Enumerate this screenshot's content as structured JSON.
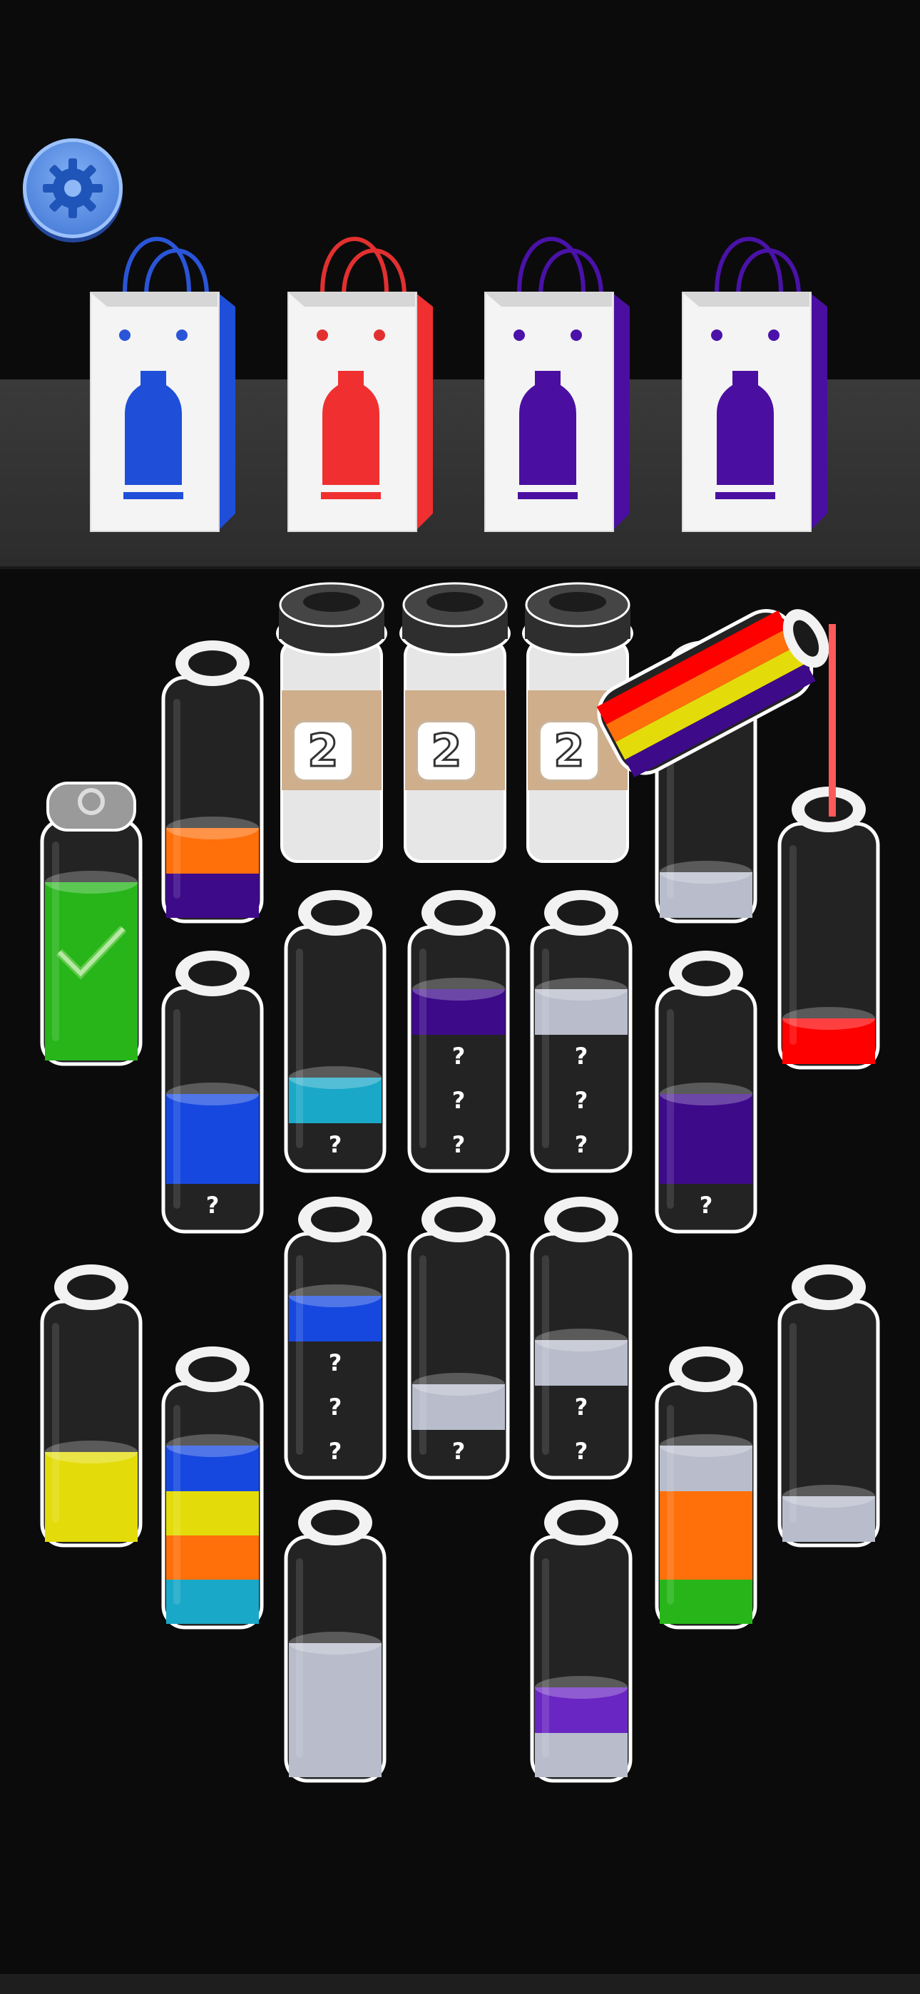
{
  "game": {
    "settings": {
      "icon": "gear-icon",
      "color": "#4a80e0"
    },
    "bags": [
      {
        "color": "#1f4fd8",
        "handle": "#2a55d8"
      },
      {
        "color": "#f03030",
        "handle": "#e23030"
      },
      {
        "color": "#4a0fa0",
        "handle": "#4a12a8"
      },
      {
        "color": "#4a0fa0",
        "handle": "#4a12a8"
      }
    ],
    "cups": [
      {
        "label": "2"
      },
      {
        "label": "2"
      },
      {
        "label": "2"
      }
    ],
    "colors": {
      "orange": "#ff6f0a",
      "purple": "#3d0a8a",
      "violet": "#6a26c2",
      "blue": "#1648e0",
      "cyan": "#1aa8c8",
      "gray": "#b8bccb",
      "red": "#ff0000",
      "yellow": "#e3dc0a",
      "green": "#27b51a",
      "dark": "#222222"
    },
    "bottles": [
      {
        "id": "b1",
        "layers": [
          "purple",
          "orange"
        ],
        "unknown": 0,
        "lid": false
      },
      {
        "id": "b2",
        "layers": [
          "gray"
        ],
        "unknown": 0,
        "lid": false
      },
      {
        "id": "b3",
        "layers": [
          "red"
        ],
        "unknown": 0,
        "lid": false
      },
      {
        "id": "b4",
        "layers": [
          "green",
          "green",
          "green",
          "green"
        ],
        "unknown": 0,
        "lid": true,
        "complete": true
      },
      {
        "id": "b5",
        "layers": [
          "blue",
          "blue"
        ],
        "unknown": 1,
        "lid": false
      },
      {
        "id": "b6",
        "layers": [
          "cyan"
        ],
        "unknown": 1,
        "lid": false
      },
      {
        "id": "b7",
        "layers": [
          "purple"
        ],
        "unknown": 3,
        "lid": false
      },
      {
        "id": "b8",
        "layers": [
          "gray"
        ],
        "unknown": 3,
        "lid": false
      },
      {
        "id": "b9",
        "layers": [
          "purple",
          "purple"
        ],
        "unknown": 1,
        "lid": false
      },
      {
        "id": "b10",
        "layers": [
          "yellow",
          "yellow"
        ],
        "unknown": 0,
        "lid": false
      },
      {
        "id": "b11",
        "layers": [
          "cyan",
          "orange",
          "yellow",
          "blue"
        ],
        "unknown": 0,
        "lid": false
      },
      {
        "id": "b12",
        "layers": [
          "blue"
        ],
        "unknown": 3,
        "lid": false
      },
      {
        "id": "b13",
        "layers": [
          "gray"
        ],
        "unknown": 1,
        "lid": false
      },
      {
        "id": "b14",
        "layers": [
          "gray"
        ],
        "unknown": 2,
        "lid": false
      },
      {
        "id": "b15",
        "layers": [
          "green",
          "orange",
          "orange",
          "gray"
        ],
        "unknown": 0,
        "lid": false
      },
      {
        "id": "b16",
        "layers": [
          "gray"
        ],
        "unknown": 0,
        "lid": false
      },
      {
        "id": "b17",
        "layers": [
          "gray",
          "gray",
          "gray"
        ],
        "unknown": 0,
        "lid": false
      },
      {
        "id": "b18",
        "layers": [
          "gray",
          "violet"
        ],
        "unknown": 0,
        "lid": false
      }
    ],
    "pouring_bottle": {
      "layers": [
        "purple",
        "yellow",
        "orange",
        "red"
      ],
      "stream": "#ff5a5a"
    },
    "question_mark": "?"
  }
}
